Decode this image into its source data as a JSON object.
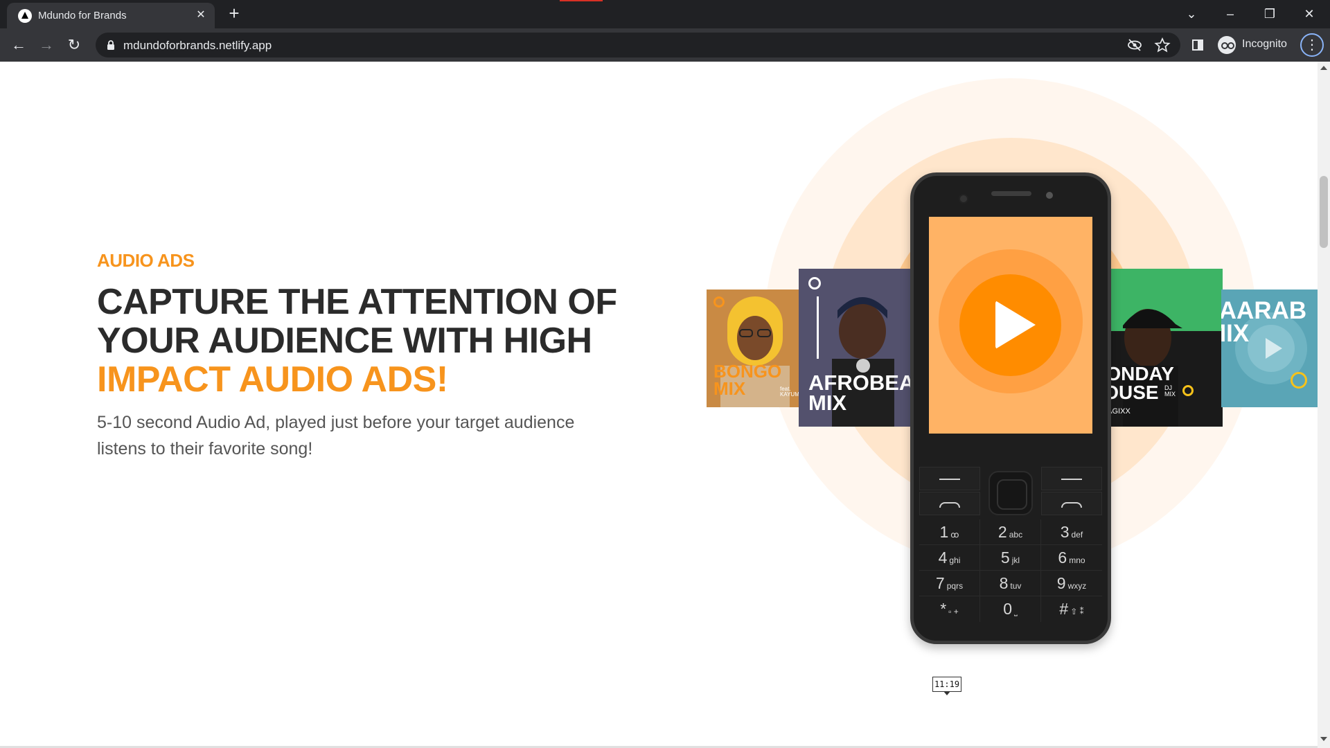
{
  "browser": {
    "tab_title": "Mdundo for Brands",
    "tab_close": "✕",
    "new_tab": "+",
    "url": "mdundoforbrands.netlify.app",
    "profile_label": "Incognito",
    "window_controls": [
      "⌄",
      "–",
      "❐",
      "✕"
    ],
    "accent": "#8ab4f8"
  },
  "hero": {
    "eyebrow": "AUDIO ADS",
    "headline_part1": "CAPTURE THE ATTENTION OF YOUR AUDIENCE WITH HIGH ",
    "headline_highlight": "IMPACT AUDIO ADS!",
    "subtext": "5-10 second Audio Ad, played just before your target audience listens to their favorite song!",
    "accent_color": "#f7941d"
  },
  "playlists": [
    {
      "label": "BONGO MIX",
      "credit": "feat. KAYUMBA"
    },
    {
      "label": "AFROBEAT MIX"
    },
    {
      "label": "MONDAY HOUSE",
      "credit": "DJ MIX",
      "artist": "MAGIXX"
    },
    {
      "label": "TAARAB MIX"
    }
  ],
  "keypad": [
    {
      "num": "1",
      "sub": "ꝏ"
    },
    {
      "num": "2",
      "sub": "abc"
    },
    {
      "num": "3",
      "sub": "def"
    },
    {
      "num": "4",
      "sub": "ghi"
    },
    {
      "num": "5",
      "sub": "jkl"
    },
    {
      "num": "6",
      "sub": "mno"
    },
    {
      "num": "7",
      "sub": "pqrs"
    },
    {
      "num": "8",
      "sub": "tuv"
    },
    {
      "num": "9",
      "sub": "wxyz"
    },
    {
      "num": "*",
      "sub": "▫ +"
    },
    {
      "num": "0",
      "sub": "⎵"
    },
    {
      "num": "#",
      "sub": "⇧ ⁑"
    }
  ],
  "video_time": "11:19"
}
